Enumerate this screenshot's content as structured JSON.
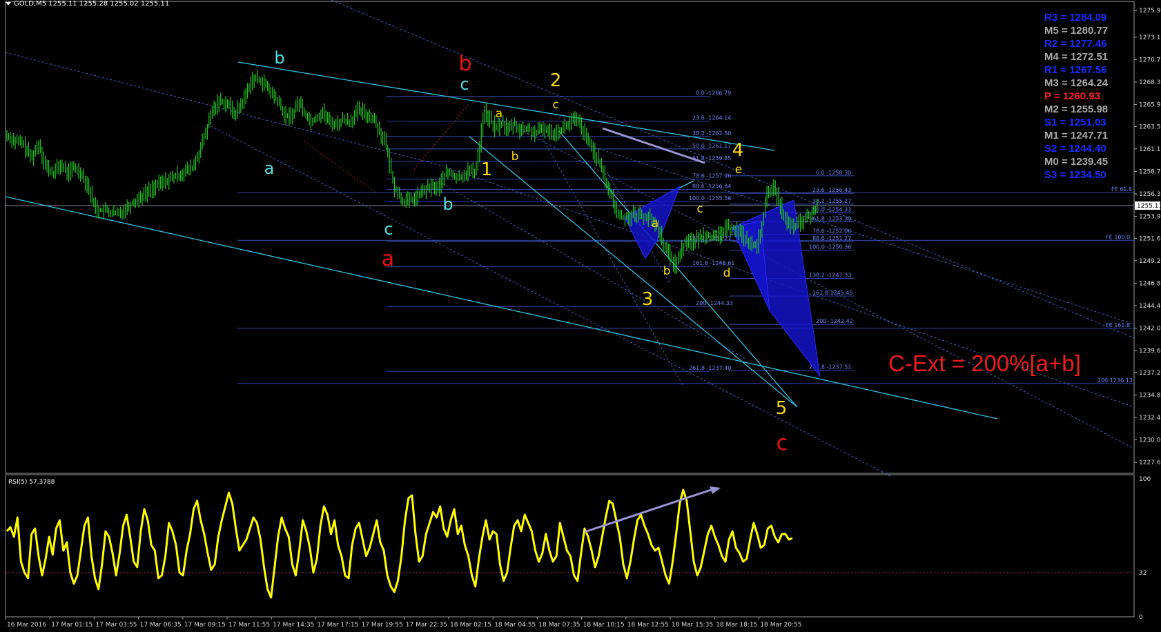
{
  "header": {
    "symbol_text": "GOLD,M5  1255.11 1255.28 1255.02 1255.11"
  },
  "rsi_header": "RSI(5) 57.3788",
  "annotation": "C-Ext = 200%[a+b]",
  "colors": {
    "price_bar": "#22c322",
    "rsi": "#ffff00",
    "pivot_blue": "#1a2cff",
    "pivot_gray": "#a9a9a9",
    "pivot_red": "#ff2020",
    "fib_line": "#3c4fbf",
    "trend_cyan": "#2ec4e6",
    "wave_red": "#ee1111",
    "wave_yellow": "#ffdd00",
    "wave_cyan": "#4fe3e3",
    "harmonic_fill": "#1414c8"
  },
  "pivots": [
    {
      "label": "R3 = 1284.09",
      "color": "blue"
    },
    {
      "label": "M5 = 1280.77",
      "color": "gray"
    },
    {
      "label": "R2 = 1277.46",
      "color": "blue"
    },
    {
      "label": "M4 = 1272.51",
      "color": "gray"
    },
    {
      "label": "R1 = 1267.56",
      "color": "blue"
    },
    {
      "label": "M3 = 1264.24",
      "color": "gray"
    },
    {
      "label": "P  = 1260.93",
      "color": "red"
    },
    {
      "label": "M2 = 1255.98",
      "color": "gray"
    },
    {
      "label": "S1 = 1251.03",
      "color": "blue"
    },
    {
      "label": "M1 = 1247.71",
      "color": "gray"
    },
    {
      "label": "S2 = 1244.40",
      "color": "blue"
    },
    {
      "label": "M0 = 1239.45",
      "color": "gray"
    },
    {
      "label": "S3 = 1234.50",
      "color": "blue"
    }
  ],
  "wave_labels": [
    {
      "text": "b",
      "color": "cyan",
      "size": 24
    },
    {
      "text": "a",
      "color": "cyan",
      "size": 24
    },
    {
      "text": "c",
      "color": "cyan",
      "size": 24
    },
    {
      "text": "a",
      "color": "red",
      "size": 30
    },
    {
      "text": "b",
      "color": "red",
      "size": 30
    },
    {
      "text": "c",
      "color": "cyan",
      "size": 24
    },
    {
      "text": "b",
      "color": "cyan",
      "size": 24
    },
    {
      "text": "2",
      "color": "yellow",
      "size": 26
    },
    {
      "text": "c",
      "color": "yellow",
      "size": 17
    },
    {
      "text": "a",
      "color": "yellow",
      "size": 17
    },
    {
      "text": "1",
      "color": "yellow",
      "size": 26
    },
    {
      "text": "b",
      "color": "yellow",
      "size": 17
    },
    {
      "text": "3",
      "color": "yellow",
      "size": 26
    },
    {
      "text": "a",
      "color": "yellow",
      "size": 17
    },
    {
      "text": "b",
      "color": "yellow",
      "size": 17
    },
    {
      "text": "c",
      "color": "yellow",
      "size": 17
    },
    {
      "text": "4",
      "color": "yellow",
      "size": 26
    },
    {
      "text": "e",
      "color": "yellow",
      "size": 17
    },
    {
      "text": "d",
      "color": "yellow",
      "size": 17
    },
    {
      "text": "5",
      "color": "yellow",
      "size": 26
    },
    {
      "text": "c",
      "color": "red",
      "size": 30
    }
  ],
  "fib_labels": [
    "0.0 -1266.79",
    "23.6 -1264.14",
    "38.2 -1262.50",
    "50.0 -1261.17",
    "61.8 -1259.85",
    "78.6 -1257.96",
    "88.6 -1256.84",
    "100.0 -1255.56",
    "138.2 -1251.27",
    "161.8 -1248.61",
    "200- 1244.33",
    "261.8 -1237.40",
    "0.0 -1258.30",
    "23.6 -1256.43",
    "38.2 -1255.27",
    "50.0 -1254.33",
    "61.8 -1253.39",
    "78.6 -1252.06",
    "88.6 -1251.27",
    "100.0 -1250.36",
    "138.2 -1247.33",
    "161.8 1245.45",
    "200- 1242.42",
    "261.8 -1237.51",
    "FE 61.8",
    "FE 100.0",
    "FE 161.8",
    "200 1236.13"
  ],
  "chart_data": [
    {
      "type": "candlestick",
      "title": "GOLD,M5",
      "ylim": [
        1226.5,
        1276.5
      ],
      "y_ticks": [
        "1275.97",
        "1273.12",
        "1270.72",
        "1268.32",
        "1265.92",
        "1263.57",
        "1261.17",
        "1258.77",
        "1256.37",
        "1253.97",
        "1251.62",
        "1249.22",
        "1246.82",
        "1244.42",
        "1242.02",
        "1239.62",
        "1237.27",
        "1234.87",
        "1232.47",
        "1230.07",
        "1227.67"
      ],
      "current_price": "1255.11",
      "x_ticks": [
        "16 Mar 2016",
        "17 Mar 01:15",
        "17 Mar 03:55",
        "17 Mar 06:35",
        "17 Mar 09:15",
        "17 Mar 11:55",
        "17 Mar 14:35",
        "17 Mar 17:15",
        "17 Mar 19:55",
        "17 Mar 22:35",
        "18 Mar 02:15",
        "18 Mar 04:55",
        "18 Mar 07:35",
        "18 Mar 10:15",
        "18 Mar 12:55",
        "18 Mar 15:35",
        "18 Mar 18:15",
        "18 Mar 20:55"
      ],
      "close_path": [
        [
          0,
          1262.6
        ],
        [
          10,
          1262.0
        ],
        [
          20,
          1261.8
        ],
        [
          32,
          1260.2
        ],
        [
          42,
          1261.8
        ],
        [
          50,
          1259.4
        ],
        [
          60,
          1258.5
        ],
        [
          70,
          1259.5
        ],
        [
          80,
          1258.6
        ],
        [
          88,
          1259.2
        ],
        [
          98,
          1258.6
        ],
        [
          106,
          1257.3
        ],
        [
          114,
          1255.3
        ],
        [
          120,
          1254.6
        ],
        [
          130,
          1254.6
        ],
        [
          138,
          1254.3
        ],
        [
          146,
          1254.2
        ],
        [
          156,
          1254.8
        ],
        [
          166,
          1255.5
        ],
        [
          180,
          1256.3
        ],
        [
          190,
          1256.9
        ],
        [
          200,
          1257.4
        ],
        [
          212,
          1257.9
        ],
        [
          222,
          1258.2
        ],
        [
          235,
          1258.8
        ],
        [
          245,
          1259.2
        ],
        [
          256,
          1261.5
        ],
        [
          262,
          1263.0
        ],
        [
          270,
          1265.2
        ],
        [
          280,
          1266.4
        ],
        [
          290,
          1266.0
        ],
        [
          300,
          1264.9
        ],
        [
          312,
          1266.5
        ],
        [
          322,
          1268.6
        ],
        [
          332,
          1268.6
        ],
        [
          340,
          1268.0
        ],
        [
          350,
          1266.9
        ],
        [
          356,
          1266.4
        ],
        [
          366,
          1264.6
        ],
        [
          376,
          1264.8
        ],
        [
          384,
          1266.3
        ],
        [
          392,
          1265.0
        ],
        [
          400,
          1264.1
        ],
        [
          408,
          1264.6
        ],
        [
          416,
          1265.1
        ],
        [
          424,
          1264.1
        ],
        [
          434,
          1263.8
        ],
        [
          442,
          1264.3
        ],
        [
          452,
          1264.1
        ],
        [
          462,
          1265.3
        ],
        [
          472,
          1264.9
        ],
        [
          482,
          1264.5
        ],
        [
          492,
          1262.8
        ],
        [
          498,
          1261.9
        ],
        [
          504,
          1259.4
        ],
        [
          510,
          1257.1
        ],
        [
          520,
          1255.7
        ],
        [
          530,
          1255.6
        ],
        [
          540,
          1256.1
        ],
        [
          550,
          1256.8
        ],
        [
          560,
          1257.2
        ],
        [
          568,
          1256.9
        ],
        [
          576,
          1258.4
        ],
        [
          584,
          1258.6
        ],
        [
          592,
          1258.0
        ],
        [
          600,
          1258.3
        ],
        [
          608,
          1258.9
        ],
        [
          616,
          1258.6
        ],
        [
          622,
          1261.3
        ],
        [
          628,
          1265.3
        ],
        [
          636,
          1264.2
        ],
        [
          644,
          1263.3
        ],
        [
          652,
          1264.0
        ],
        [
          660,
          1263.2
        ],
        [
          668,
          1263.9
        ],
        [
          676,
          1263.1
        ],
        [
          684,
          1263.4
        ],
        [
          696,
          1262.8
        ],
        [
          706,
          1263.4
        ],
        [
          716,
          1262.9
        ],
        [
          726,
          1263.1
        ],
        [
          736,
          1263.6
        ],
        [
          746,
          1264.3
        ],
        [
          754,
          1263.9
        ],
        [
          762,
          1262.4
        ],
        [
          770,
          1261.4
        ],
        [
          778,
          1260.0
        ],
        [
          784,
          1258.7
        ],
        [
          790,
          1257.3
        ],
        [
          796,
          1256.1
        ],
        [
          802,
          1254.5
        ],
        [
          808,
          1253.9
        ],
        [
          818,
          1253.9
        ],
        [
          828,
          1254.2
        ],
        [
          838,
          1254.0
        ],
        [
          848,
          1253.7
        ],
        [
          858,
          1252.6
        ],
        [
          866,
          1250.6
        ],
        [
          874,
          1249.6
        ],
        [
          880,
          1248.7
        ],
        [
          888,
          1250.4
        ],
        [
          896,
          1251.6
        ],
        [
          904,
          1251.1
        ],
        [
          912,
          1251.8
        ],
        [
          922,
          1252.1
        ],
        [
          932,
          1251.5
        ],
        [
          942,
          1252.3
        ],
        [
          952,
          1252.9
        ],
        [
          962,
          1252.5
        ],
        [
          972,
          1251.6
        ],
        [
          982,
          1250.7
        ],
        [
          988,
          1250.9
        ],
        [
          994,
          1253.0
        ],
        [
          1002,
          1256.7
        ],
        [
          1008,
          1257.1
        ],
        [
          1016,
          1255.8
        ],
        [
          1024,
          1253.6
        ],
        [
          1032,
          1252.8
        ],
        [
          1042,
          1253.1
        ],
        [
          1052,
          1253.7
        ],
        [
          1062,
          1254.4
        ],
        [
          1068,
          1255.0
        ]
      ]
    },
    {
      "type": "line",
      "title": "RSI(5) 57.3788",
      "ylim": [
        0,
        100
      ],
      "y_ticks": [
        "100",
        "32",
        "0"
      ],
      "series": [
        {
          "name": "RSI(5)",
          "values": [
            62,
            65,
            58,
            72,
            40,
            32,
            28,
            60,
            64,
            44,
            30,
            42,
            58,
            45,
            64,
            70,
            48,
            54,
            32,
            24,
            30,
            48,
            66,
            72,
            44,
            28,
            20,
            38,
            62,
            58,
            46,
            30,
            46,
            66,
            74,
            58,
            40,
            36,
            62,
            78,
            70,
            52,
            48,
            28,
            30,
            44,
            68,
            62,
            52,
            32,
            30,
            48,
            60,
            78,
            84,
            70,
            60,
            46,
            34,
            38,
            58,
            70,
            80,
            90,
            82,
            64,
            48,
            52,
            56,
            64,
            72,
            68,
            56,
            36,
            20,
            14,
            36,
            58,
            72,
            64,
            58,
            38,
            30,
            48,
            70,
            62,
            50,
            32,
            42,
            66,
            80,
            74,
            60,
            70,
            52,
            44,
            30,
            28,
            52,
            64,
            68,
            56,
            44,
            50,
            60,
            70,
            54,
            48,
            30,
            22,
            18,
            26,
            44,
            70,
            86,
            88,
            60,
            40,
            44,
            60,
            68,
            76,
            72,
            80,
            64,
            58,
            70,
            78,
            60,
            66,
            52,
            44,
            30,
            22,
            42,
            58,
            70,
            56,
            62,
            60,
            38,
            26,
            32,
            50,
            66,
            70,
            62,
            74,
            68,
            62,
            48,
            40,
            46,
            60,
            48,
            40,
            44,
            68,
            58,
            48,
            44,
            30,
            26,
            46,
            64,
            58,
            48,
            36,
            44,
            58,
            72,
            84,
            82,
            70,
            58,
            38,
            28,
            40,
            56,
            70,
            74,
            66,
            60,
            52,
            48,
            50,
            40,
            30,
            24,
            40,
            60,
            82,
            92,
            84,
            62,
            40,
            30,
            36,
            48,
            60,
            66,
            58,
            52,
            44,
            40,
            56,
            62,
            50,
            46,
            40,
            42,
            56,
            68,
            60,
            50,
            52,
            64,
            66,
            58,
            54,
            60,
            60,
            56,
            57
          ]
        }
      ],
      "levels": [
        32
      ]
    }
  ]
}
